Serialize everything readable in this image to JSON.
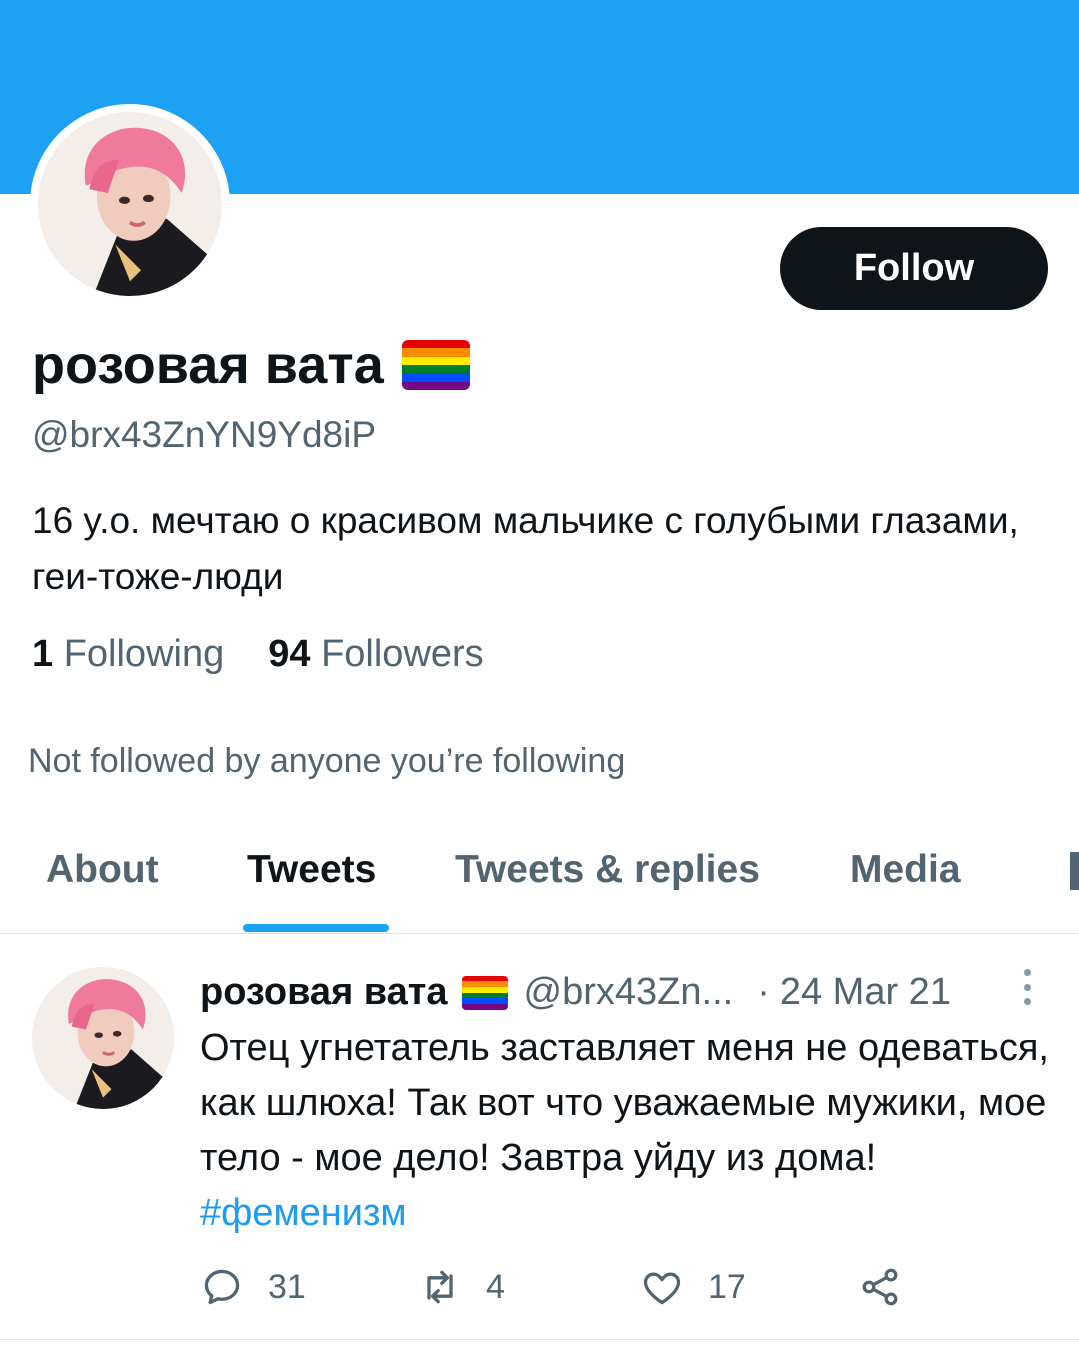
{
  "profile": {
    "display_name": "розовая вата",
    "flag_icon": "rainbow-flag-icon",
    "handle": "@brx43ZnYN9Yd8iP",
    "bio": "16 y.o.  мечтаю о красивом мальчике с голубыми глазами, геи-тоже-люди",
    "following_count": "1",
    "following_label": "Following",
    "followers_count": "94",
    "followers_label": "Followers",
    "not_followed_text": "Not followed by anyone you’re following",
    "follow_button_label": "Follow"
  },
  "tabs": [
    {
      "label": "About"
    },
    {
      "label": "Tweets"
    },
    {
      "label": "Tweets & replies"
    },
    {
      "label": "Media"
    }
  ],
  "active_tab": "Tweets",
  "tweet": {
    "name": "розовая вата",
    "handle": "@brx43Zn...",
    "separator": "·",
    "date": "24 Mar 21",
    "text_main": "Отец угнетатель заставляет меня не одеваться, как шлюха! Так вот что уважаемые мужики, мое тело - мое дело! Завтра уйду из дома!",
    "hashtag": "#феменизм",
    "reply_count": "31",
    "retweet_count": "4",
    "like_count": "17"
  },
  "colors": {
    "banner": "#1da1f2",
    "accent": "#1d9bf0",
    "text_primary": "#0f1419",
    "text_secondary": "#536471",
    "follow_button_bg": "#0f1419",
    "flag_stripes": [
      "#e40303",
      "#ff8c00",
      "#ffed00",
      "#008026",
      "#004dff",
      "#750787"
    ]
  }
}
